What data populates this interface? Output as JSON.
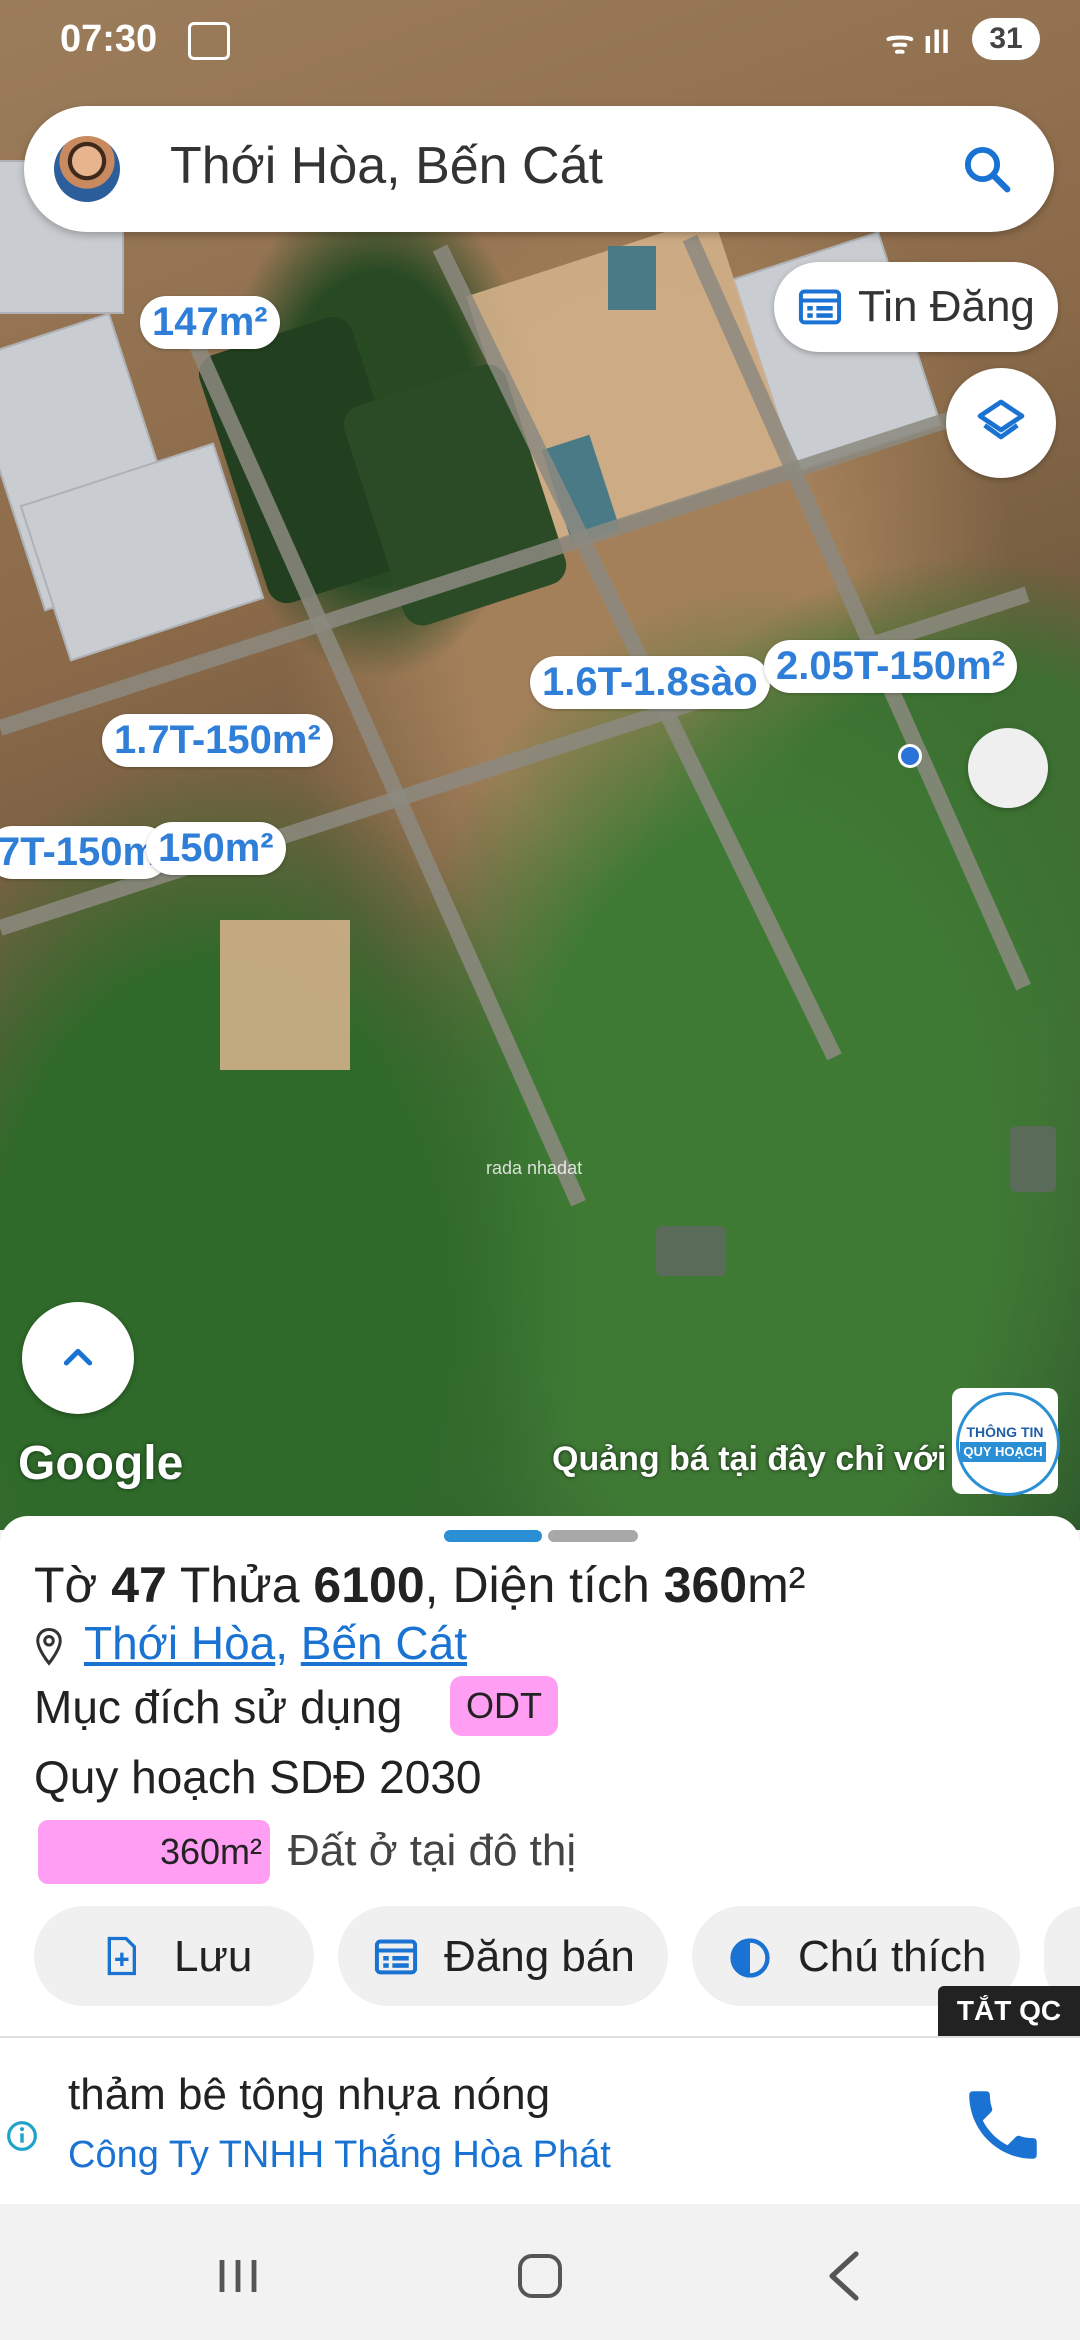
{
  "status_bar": {
    "time": "07:30",
    "battery": "31"
  },
  "search": {
    "query": "Thới Hòa, Bến Cát"
  },
  "tin_dang": {
    "label": "Tin Đăng"
  },
  "map": {
    "price_labels": [
      "147m²",
      "1.6T-1.8sào",
      "2.05T-150m²",
      "1.7T-150m²",
      "7T-150m",
      "150m²"
    ],
    "google_label": "Google",
    "ad_text": "Quảng bá tại đây chỉ với 2030",
    "planning_badge": {
      "line1": "THÔNG TIN",
      "line2": "QUY HOẠCH"
    },
    "watermark": "rada nhadat"
  },
  "parcel": {
    "to_label": "Tờ",
    "to_value": "47",
    "thua_label": "Thửa",
    "thua_value": "6100",
    "area_label": ", Diện tích",
    "area_value": "360",
    "area_unit": "m²",
    "location_ward": "Thới Hòa",
    "location_separator": ",",
    "location_district": "Bến Cát",
    "purpose_label": "Mục đích sử dụng",
    "purpose_code": "ODT",
    "plan_label": "Quy hoạch SDĐ 2030",
    "plan_area": "360m²",
    "plan_desc": "Đất ở tại đô thị",
    "plan_color": "#ff9ef3"
  },
  "actions": {
    "save": "Lưu",
    "post": "Đăng bán",
    "legend": "Chú thích"
  },
  "ad_close": "TẮT QC",
  "ad": {
    "headline": "thảm bê tông nhựa nóng",
    "company": "Công Ty TNHH Thắng Hòa Phát"
  },
  "colors": {
    "accent": "#1a73d2",
    "odt": "#ff9ef3",
    "price_text": "#2f7ed8"
  }
}
